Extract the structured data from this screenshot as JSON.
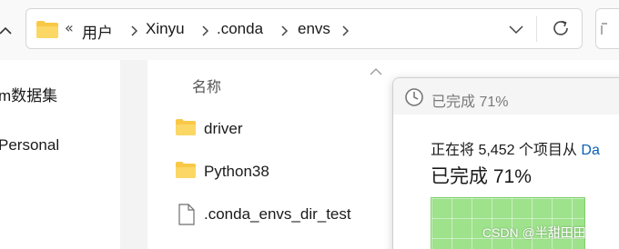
{
  "address_bar": {
    "overflow_marker": "«",
    "breadcrumbs": [
      "用户",
      "Xinyu",
      ".conda",
      "envs"
    ]
  },
  "sidebar": {
    "items": [
      {
        "label": "m数据集",
        "icon": "none"
      },
      {
        "label": "Personal",
        "icon": "none"
      }
    ]
  },
  "file_list": {
    "column_header": "名称",
    "files": [
      {
        "name": "driver",
        "icon": "folder-icon"
      },
      {
        "name": "Python38",
        "icon": "folder-icon"
      },
      {
        "name": ".conda_envs_dir_test",
        "icon": "file-icon"
      }
    ]
  },
  "progress_dialog": {
    "title": "已完成 71%",
    "status_prefix": "正在将 5,452 个项目从 ",
    "status_link": "Da",
    "big_status": "已完成 71%",
    "progress_fraction": 0.71
  },
  "watermark": "CSDN @半甜田田",
  "colors": {
    "folder_yellow": "#f8c846",
    "progress_green": "#9ee28c",
    "link_blue": "#0a5fb4"
  }
}
